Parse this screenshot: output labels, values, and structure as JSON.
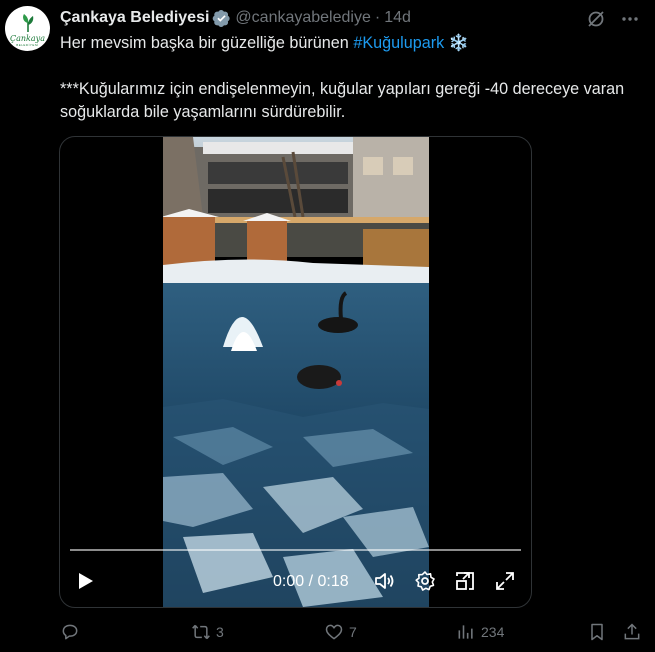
{
  "tweet": {
    "author_name": "Çankaya Belediyesi",
    "handle": "@cankayabelediye",
    "separator": "·",
    "time": "14d",
    "avatar": {
      "brand": "Çankaya",
      "sub": "BELEDİYESİ"
    },
    "text_line1_prefix": "Her mevsim başka bir güzelliğe bürünen ",
    "hashtag": "#Kuğulupark",
    "emoji": "❄️",
    "text_para2": "***Kuğularımız için endişelenmeyin, kuğular yapıları gereği -40 dereceye varan soğuklarda bile yaşamlarını sürdürebilir."
  },
  "video": {
    "timecode": "0:00 / 0:18",
    "progress_fraction": 0.0
  },
  "actions": {
    "replies": "",
    "retweets": "3",
    "likes": "7",
    "views": "234"
  },
  "icons": {
    "top": [
      "grok-icon",
      "more-icon"
    ],
    "video_controls": [
      "play-icon",
      "volume-icon",
      "settings-icon",
      "pip-icon",
      "fullscreen-icon"
    ],
    "actions": [
      "reply-icon",
      "retweet-icon",
      "like-icon",
      "views-icon",
      "bookmark-icon",
      "share-icon"
    ]
  },
  "colors": {
    "background": "#000000",
    "text": "#e7e9ea",
    "muted": "#71767b",
    "link": "#1d9bf0",
    "verified": "#829aab",
    "brand_green": "#1d7a3a"
  }
}
